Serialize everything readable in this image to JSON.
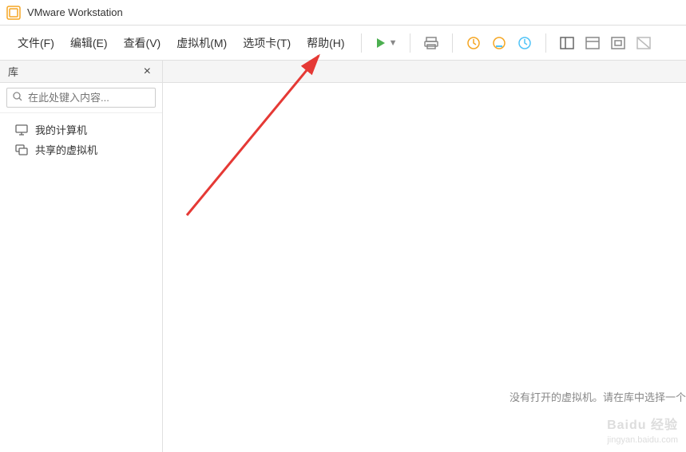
{
  "app": {
    "title": "VMware Workstation"
  },
  "menubar": {
    "file": "文件(F)",
    "edit": "编辑(E)",
    "view": "查看(V)",
    "vm": "虚拟机(M)",
    "tabs": "选项卡(T)",
    "help": "帮助(H)"
  },
  "sidebar": {
    "title": "库",
    "close_symbol": "×",
    "search_placeholder": "在此处键入内容...",
    "items": [
      {
        "label": "我的计算机"
      },
      {
        "label": "共享的虚拟机"
      }
    ]
  },
  "main": {
    "empty_message": "没有打开的虚拟机。请在库中选择一个"
  },
  "watermark": {
    "line1": "Baidu 经验",
    "line2": "jingyan.baidu.com"
  }
}
